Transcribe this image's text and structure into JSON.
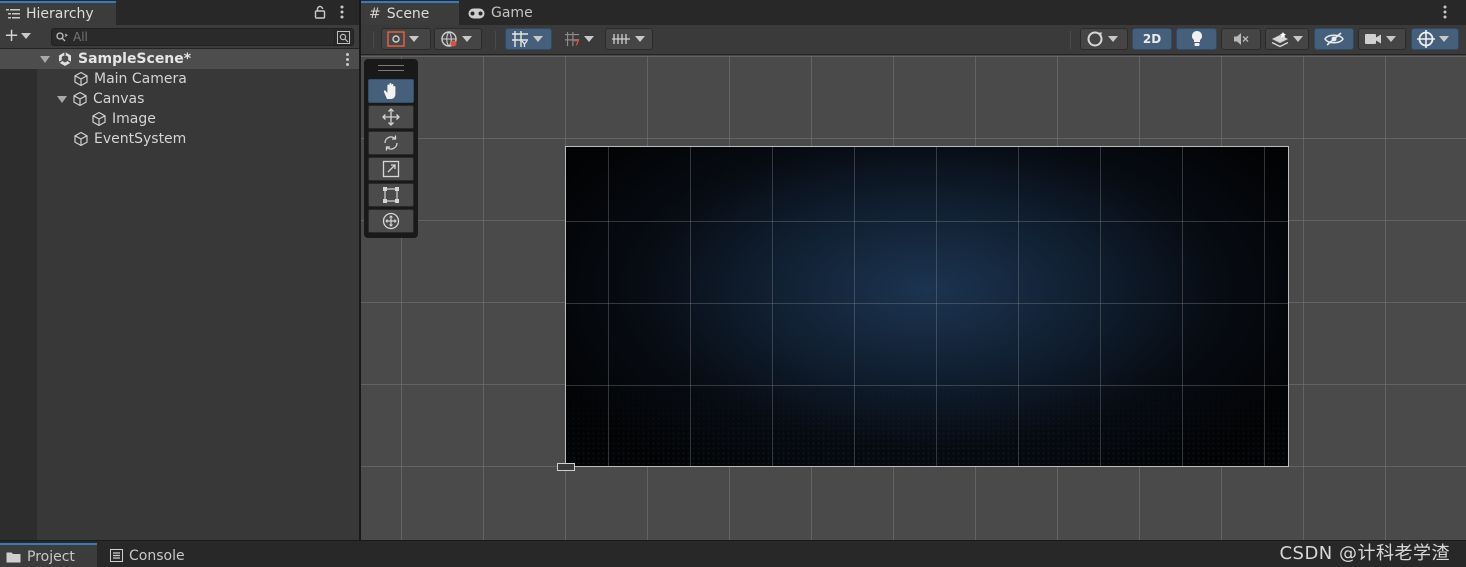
{
  "hierarchy": {
    "tab_label": "Hierarchy",
    "search_placeholder": "All",
    "scene_name": "SampleScene*",
    "items": [
      {
        "label": "Main Camera"
      },
      {
        "label": "Canvas"
      },
      {
        "label": "Image"
      },
      {
        "label": "EventSystem"
      }
    ]
  },
  "scene_view": {
    "tabs": [
      {
        "label": "Scene"
      },
      {
        "label": "Game"
      }
    ],
    "toolbar": {
      "mode_2d_label": "2D"
    },
    "tools": [
      "hand-tool",
      "move-tool",
      "rotate-tool",
      "scale-tool",
      "rect-tool",
      "transform-tool"
    ]
  },
  "bottom": {
    "tabs": [
      {
        "label": "Project"
      },
      {
        "label": "Console"
      }
    ]
  },
  "watermark": "CSDN @计科老学渣",
  "colors": {
    "accent": "#3a79bb",
    "selected_tool": "#46607c",
    "panel_bg": "#383838"
  }
}
